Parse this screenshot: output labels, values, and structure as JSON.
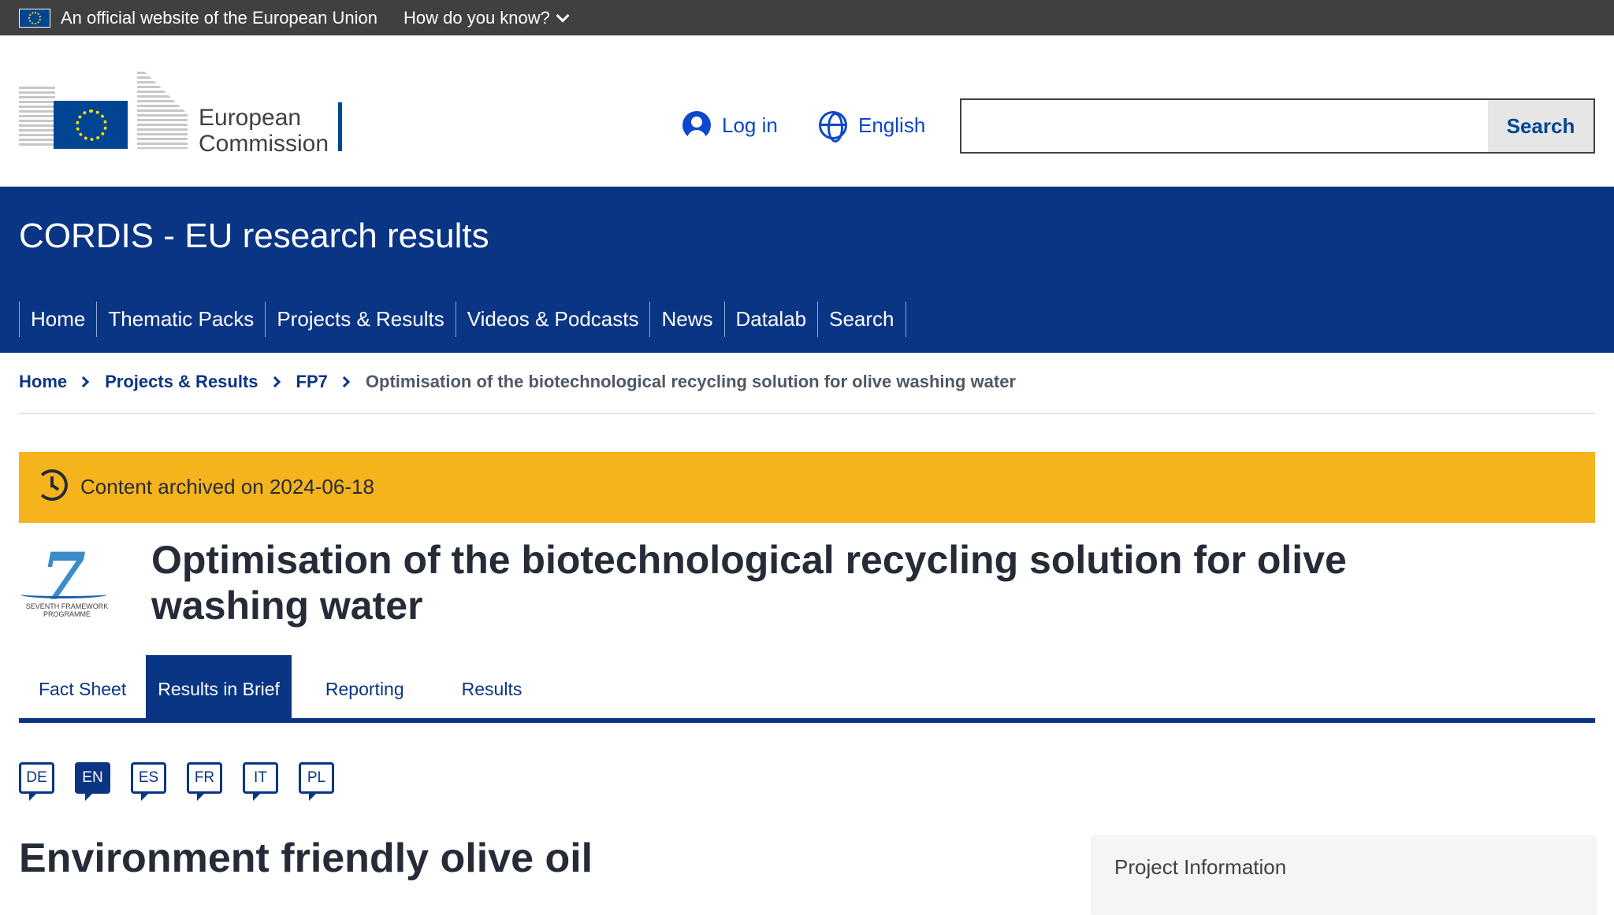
{
  "top_bar": {
    "official_text": "An official website of the European Union",
    "how_text": "How do you know?"
  },
  "header": {
    "logo_line1": "European",
    "logo_line2": "Commission",
    "login_label": "Log in",
    "language_label": "English",
    "search_placeholder": "",
    "search_button": "Search"
  },
  "site": {
    "title": "CORDIS - EU research results",
    "nav": [
      "Home",
      "Thematic Packs",
      "Projects & Results",
      "Videos & Podcasts",
      "News",
      "Datalab",
      "Search"
    ]
  },
  "breadcrumb": {
    "items": [
      "Home",
      "Projects & Results",
      "FP7"
    ],
    "current": "Optimisation of the biotechnological recycling solution for olive washing water"
  },
  "notice": {
    "text": "Content archived on 2024-06-18"
  },
  "project": {
    "programme_logo_caption": "SEVENTH FRAMEWORK PROGRAMME",
    "title": "Optimisation of the biotechnological recycling solution for olive washing water",
    "tabs": [
      "Fact Sheet",
      "Results in Brief",
      "Reporting",
      "Results"
    ],
    "active_tab": "Results in Brief"
  },
  "languages": {
    "items": [
      "DE",
      "EN",
      "ES",
      "FR",
      "IT",
      "PL"
    ],
    "active": "EN"
  },
  "article": {
    "title": "Environment friendly olive oil",
    "side_panel_heading": "Project Information"
  },
  "colors": {
    "top_bar": "#404040",
    "site_banner": "#0a3584",
    "notice": "#f5b41c",
    "link": "#0e47cb"
  }
}
